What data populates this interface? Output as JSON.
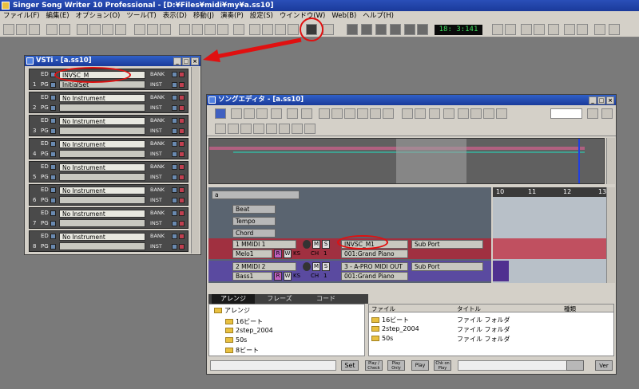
{
  "app": {
    "title": "Singer Song Writer 10 Professional - [D:¥Files¥midi¥my¥a.ss10]"
  },
  "menu": [
    "ファイル(F)",
    "編集(E)",
    "オプション(O)",
    "ツール(T)",
    "表示(D)",
    "移動(J)",
    "演奏(P)",
    "設定(S)",
    "ウインドウ(W)",
    "Web(B)",
    "ヘルプ(H)"
  ],
  "transport": {
    "timecode": "18: 3:141"
  },
  "vsti": {
    "title": "VSTi - [a.ss10]",
    "rows": [
      {
        "num": "1",
        "name": "INVSC_M",
        "program": "InitialSet"
      },
      {
        "num": "2",
        "name": "No Instrument",
        "program": ""
      },
      {
        "num": "3",
        "name": "No Instrument",
        "program": ""
      },
      {
        "num": "4",
        "name": "No Instrument",
        "program": ""
      },
      {
        "num": "5",
        "name": "No Instrument",
        "program": ""
      },
      {
        "num": "6",
        "name": "No Instrument",
        "program": ""
      },
      {
        "num": "7",
        "name": "No Instrument",
        "program": ""
      },
      {
        "num": "8",
        "name": "No Instrument",
        "program": ""
      }
    ],
    "labels": {
      "ed": "ED",
      "pg": "PG",
      "bank": "BANK",
      "inst": "INST"
    }
  },
  "song": {
    "title": "ソングエディタ - [a.ss10]",
    "ruler": [
      "10",
      "11",
      "12",
      "13"
    ],
    "rows": {
      "beat": "Beat",
      "tempo": "Tempo",
      "chord": "Chord"
    },
    "tracks": [
      {
        "name": "1 MMIDI 1",
        "sub": "Melo1",
        "port": "INVSC_M1",
        "subport": "Sub Port",
        "inst": "001:Grand Piano",
        "ch": "CH",
        "ks": "KS",
        "ch_num": "1"
      },
      {
        "name": "2 MMIDI 2",
        "sub": "Bass1",
        "port": "3 - A-PRO MIDI OUT",
        "subport": "Sub Port",
        "inst": "001:Grand Piano",
        "ch": "CH",
        "ks": "KS",
        "ch_num": "1"
      }
    ],
    "tabs": [
      "アレンジ",
      "フレーズ",
      "コード"
    ],
    "tree": {
      "root": "アレンジ",
      "items": [
        "16ビート",
        "2step_2004",
        "50s",
        "8ビート"
      ]
    },
    "filelist": {
      "headers": [
        "ファイル",
        "タイトル",
        "種類"
      ],
      "rows": [
        {
          "file": "16ビート",
          "title": "ファイル フォルダ"
        },
        {
          "file": "2step_2004",
          "title": "ファイル フォルダ"
        },
        {
          "file": "50s",
          "title": "ファイル フォルダ"
        }
      ]
    },
    "bottom": {
      "set": "Set",
      "b1": "Play / Check",
      "b2": "Play Only",
      "b3": "Play",
      "b4": "Chk on Play",
      "b5": "Ver"
    }
  }
}
